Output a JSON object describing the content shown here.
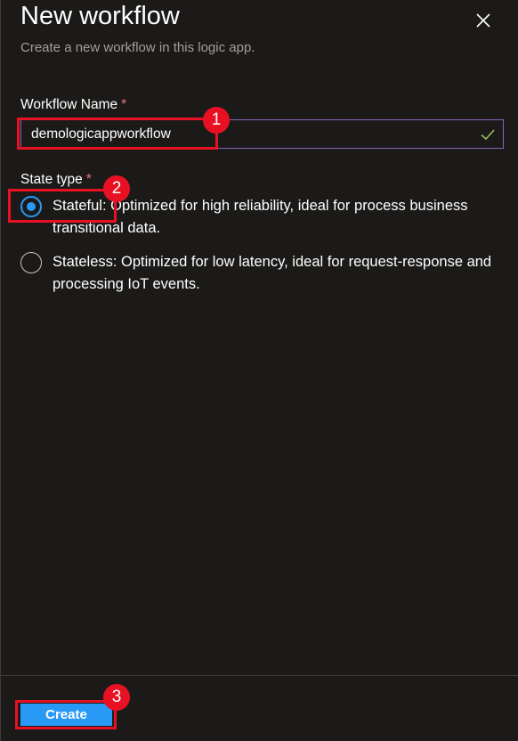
{
  "header": {
    "title": "New workflow",
    "subtitle": "Create a new workflow in this logic app."
  },
  "workflow_name": {
    "label": "Workflow Name",
    "required_marker": "*",
    "value": "demologicappworkflow"
  },
  "state_type": {
    "label": "State type",
    "required_marker": "*",
    "options": [
      {
        "text": "Stateful: Optimized for high reliability, ideal for process business transitional data.",
        "selected": true
      },
      {
        "text": "Stateless: Optimized for low latency, ideal for request-response and processing IoT events.",
        "selected": false
      }
    ]
  },
  "footer": {
    "create_label": "Create"
  },
  "callouts": [
    "1",
    "2",
    "3"
  ],
  "colors": {
    "background": "#1b1a19",
    "accent": "#2899f5",
    "callout": "#e81123",
    "required": "#f1707b",
    "valid_check": "#92c353",
    "input_border": "#8764b8"
  }
}
